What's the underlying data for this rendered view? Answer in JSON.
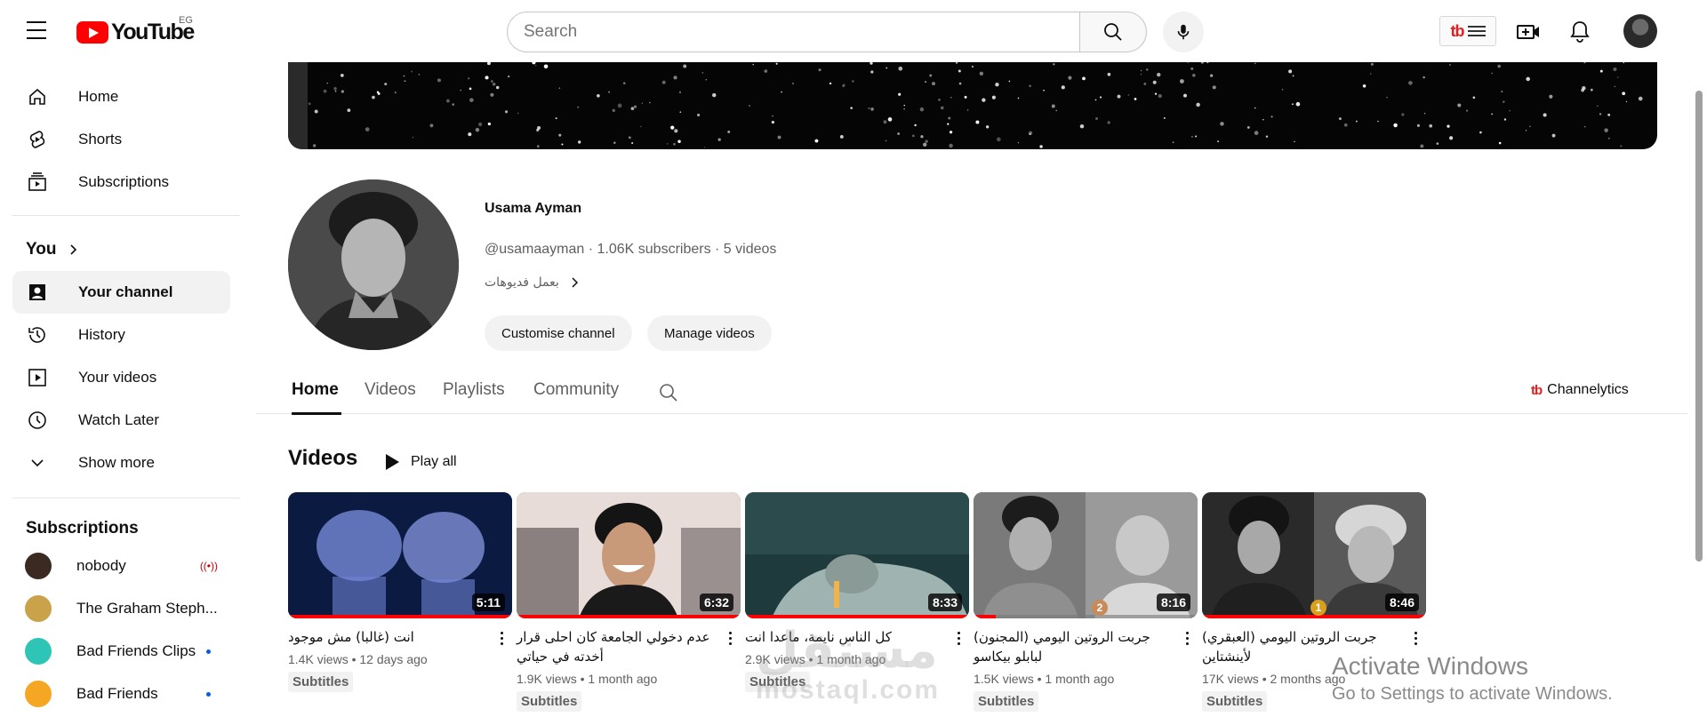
{
  "topbar": {
    "logo_text": "YouTube",
    "country": "EG",
    "search_placeholder": "Search",
    "tb_badge": "tb"
  },
  "sidebar": {
    "primary": [
      {
        "label": "Home",
        "icon": "home-icon"
      },
      {
        "label": "Shorts",
        "icon": "shorts-icon"
      },
      {
        "label": "Subscriptions",
        "icon": "subscriptions-icon"
      }
    ],
    "you_heading": "You",
    "you_items": [
      {
        "label": "Your channel",
        "icon": "your-channel-icon",
        "active": true
      },
      {
        "label": "History",
        "icon": "history-icon"
      },
      {
        "label": "Your videos",
        "icon": "your-videos-icon"
      },
      {
        "label": "Watch Later",
        "icon": "watch-later-icon"
      },
      {
        "label": "Show more",
        "icon": "chevron-down-icon"
      }
    ],
    "subscriptions_heading": "Subscriptions",
    "subscriptions": [
      {
        "label": "nobody",
        "indicator": "live",
        "color": "#3b2a22"
      },
      {
        "label": "The Graham Steph...",
        "indicator": "none",
        "color": "#c9a24a"
      },
      {
        "label": "Bad Friends Clips",
        "indicator": "dot",
        "color": "#2ec4b6"
      },
      {
        "label": "Bad Friends",
        "indicator": "dot",
        "color": "#f5a623"
      }
    ]
  },
  "channel": {
    "name": "Usama Ayman",
    "handle": "@usamaayman",
    "subscribers": "1.06K subscribers",
    "videos_count": "5 videos",
    "about": "بعمل فديوهات",
    "customise_label": "Customise channel",
    "manage_label": "Manage videos"
  },
  "tabs": [
    {
      "label": "Home",
      "active": true
    },
    {
      "label": "Videos"
    },
    {
      "label": "Playlists"
    },
    {
      "label": "Community"
    }
  ],
  "channelytics_label": "Channelytics",
  "videos_section": {
    "title": "Videos",
    "play_all": "Play all",
    "items": [
      {
        "title": "انت (غالبا) مش موجود",
        "views": "1.4K views",
        "age": "12 days ago",
        "duration": "5:11",
        "badge": "Subtitles",
        "progress": 1.0,
        "rank": ""
      },
      {
        "title": "عدم دخولي الجامعة كان احلى قرار أخدته في حياتي",
        "views": "1.9K views",
        "age": "1 month ago",
        "duration": "6:32",
        "badge": "Subtitles",
        "progress": 1.0,
        "rank": ""
      },
      {
        "title": "كل الناس نايمة، ماعدا انت",
        "views": "2.9K views",
        "age": "1 month ago",
        "duration": "8:33",
        "badge": "Subtitles",
        "progress": 1.0,
        "rank": ""
      },
      {
        "title": "جربت الروتين اليومي (المجنون) لبابلو بيكاسو",
        "views": "1.5K views",
        "age": "1 month ago",
        "duration": "8:16",
        "badge": "Subtitles",
        "progress": 0.1,
        "rank": "2"
      },
      {
        "title": "جربت الروتين اليومي (العبقري) لأينشتاين",
        "views": "17K views",
        "age": "2 months ago",
        "duration": "8:46",
        "badge": "Subtitles",
        "progress": 1.0,
        "rank": "1"
      }
    ]
  },
  "watermark": {
    "ar": "مستقل",
    "en": "mostaql.com"
  },
  "activate": {
    "title": "Activate Windows",
    "subtitle": "Go to Settings to activate Windows."
  },
  "colors": {
    "brand_red": "#ff0000",
    "text_primary": "#0f0f0f",
    "text_secondary": "#606060",
    "chip_bg": "#f2f2f2"
  }
}
